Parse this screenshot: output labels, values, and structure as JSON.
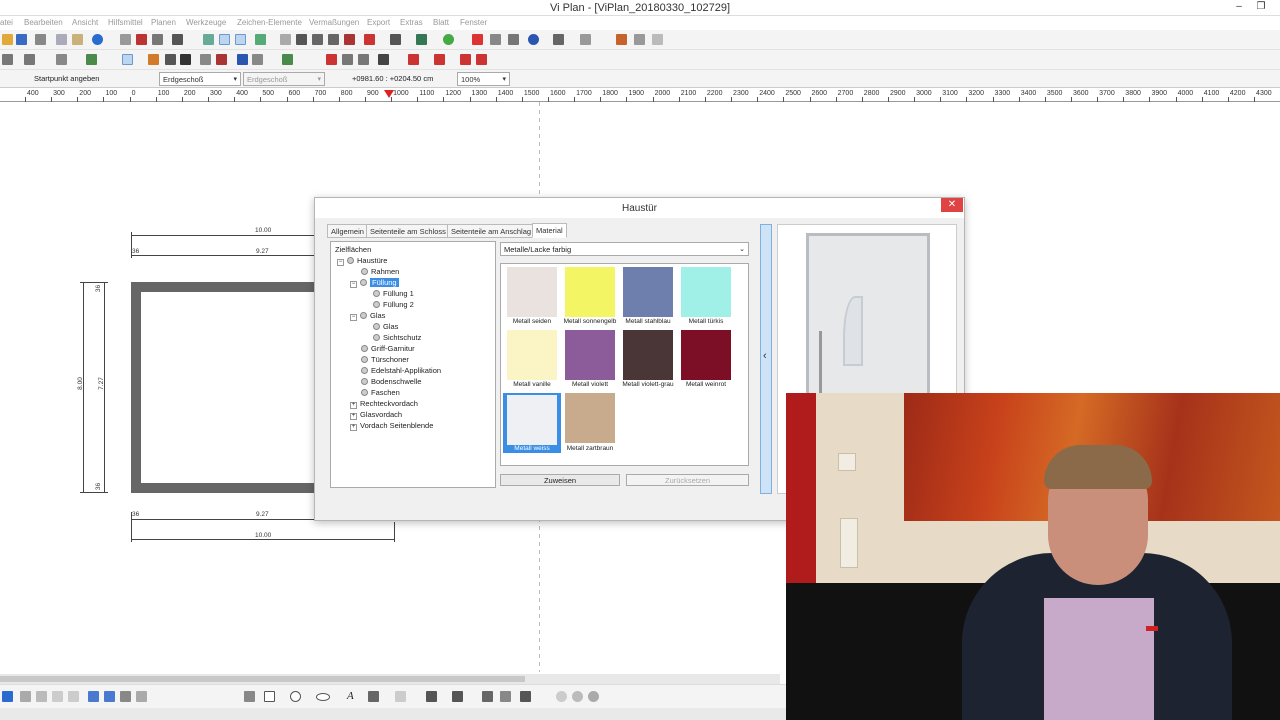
{
  "window": {
    "title": "Vi Plan - [ViPlan_20180330_102729]"
  },
  "menu": [
    "atei",
    "Bearbeiten",
    "Ansicht",
    "Hilfsmittel",
    "Planen",
    "Werkzeuge",
    "Zeichen-Elemente",
    "Vermaßungen",
    "Export",
    "Extras",
    "Blatt",
    "Fenster"
  ],
  "status": {
    "hint": "Startpunkt angeben",
    "floor": "Erdgeschoß",
    "floor2": "Erdgeschoß",
    "coords": "+0981.60 : +0204.50 cm",
    "zoom": "100%"
  },
  "ruler": [
    "400",
    "300",
    "200",
    "100",
    "0",
    "100",
    "200",
    "300",
    "400",
    "500",
    "600",
    "700",
    "800",
    "900",
    "1000",
    "1100",
    "1200",
    "1300",
    "1400",
    "1500",
    "1600",
    "1700",
    "1800",
    "1900",
    "2000",
    "2100",
    "2200",
    "2300",
    "2400",
    "2500",
    "2600",
    "2700",
    "2800",
    "2900",
    "3000",
    "3100",
    "3200",
    "3300",
    "3400",
    "3500",
    "3600",
    "3700",
    "3800",
    "3900",
    "4000",
    "4100",
    "4200",
    "4300"
  ],
  "drawing": {
    "top_outer": "10.00",
    "top_inner": "9.27",
    "top_small": "36",
    "bot_inner": "9.27",
    "bot_outer": "10.00",
    "bot_small": "36",
    "left_outer": "8.00",
    "left_inner": "7.27",
    "left_small_top": "36",
    "left_small_bot": "36"
  },
  "dialog": {
    "title": "Haustür",
    "close": "✕",
    "tabs": [
      "Allgemein",
      "Seitenteile am Schloss",
      "Seitenteile am Anschlag",
      "Material"
    ],
    "tree": {
      "root": "Zielflächen",
      "items": [
        "Haustüre",
        "Rahmen",
        "Füllung",
        "Füllung 1",
        "Füllung 2",
        "Glas",
        "Glas",
        "Sichtschutz",
        "Griff-Garnitur",
        "Türschoner",
        "Edelstahl-Applikation",
        "Bodenschwelle",
        "Faschen",
        "Rechteckvordach",
        "Glasvordach",
        "Vordach Seitenblende"
      ]
    },
    "material_category": "Metalle/Lacke farbig",
    "swatches": [
      {
        "label": "Metall seiden",
        "color": "#e9e2de"
      },
      {
        "label": "Metall sonnengelb",
        "color": "#f3f565"
      },
      {
        "label": "Metall stahlblau",
        "color": "#6f7fad"
      },
      {
        "label": "Metall türkis",
        "color": "#a0f0e8"
      },
      {
        "label": "Metall vanille",
        "color": "#fbf4c4"
      },
      {
        "label": "Metall violett",
        "color": "#8c5c9a"
      },
      {
        "label": "Metall violett-grau",
        "color": "#4a3636"
      },
      {
        "label": "Metall weinrot",
        "color": "#7c0f26"
      },
      {
        "label": "Metall weiss",
        "color": "#eef0f4"
      },
      {
        "label": "Metall zartbraun",
        "color": "#c8aa8c"
      }
    ],
    "selected_swatch": "Metall weiss",
    "buttons": {
      "assign": "Zuweisen",
      "reset": "Zurücksetzen"
    },
    "collapse": "‹"
  },
  "colors": {
    "accent": "#3a8ee6",
    "close": "#e04343"
  }
}
